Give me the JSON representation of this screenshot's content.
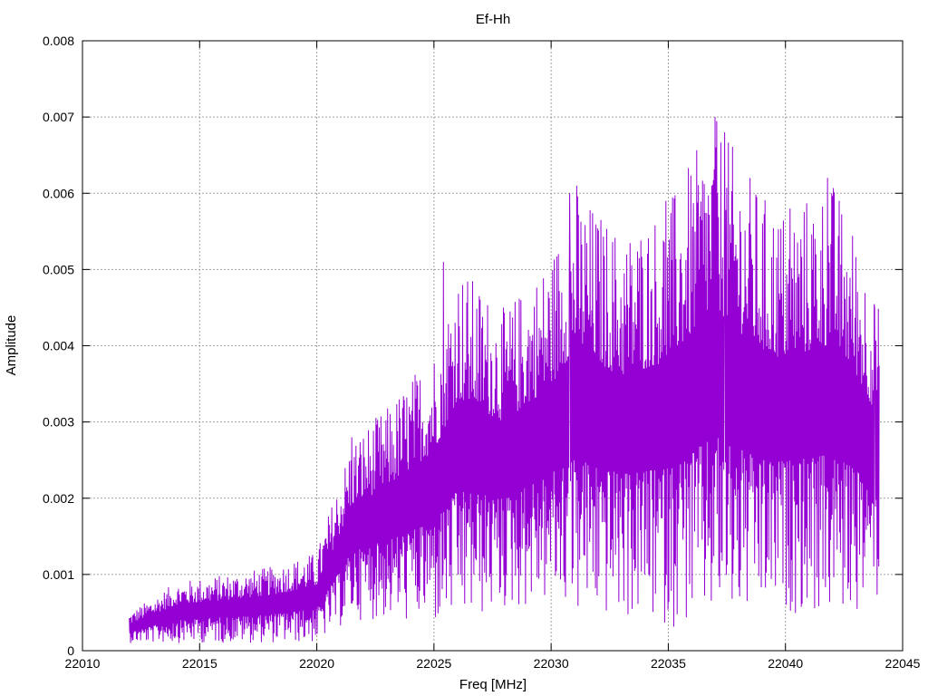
{
  "chart_data": {
    "type": "line",
    "title": "Ef-Hh",
    "xlabel": "Freq [MHz]",
    "ylabel": "Amplitude",
    "xlim": [
      22010,
      22045
    ],
    "ylim": [
      0,
      0.008
    ],
    "xticks": [
      "22010",
      "22015",
      "22020",
      "22025",
      "22030",
      "22035",
      "22040",
      "22045"
    ],
    "yticks": [
      "0",
      "0.001",
      "0.002",
      "0.003",
      "0.004",
      "0.005",
      "0.006",
      "0.007",
      "0.008"
    ],
    "grid": true,
    "series_color": "#9400d3",
    "series": [
      {
        "x_start": 22012.0,
        "x_end": 22044.0,
        "envelope": {
          "x": [
            22012,
            22014,
            22016,
            22018,
            22020,
            22021.5,
            22023,
            22025,
            22026,
            22028,
            22030,
            22031,
            22033,
            22035,
            22037,
            22039,
            22040,
            22042,
            22043,
            22044
          ],
          "low": [
            0.0001,
            0.0001,
            0.0001,
            0.0001,
            0.0001,
            0.0004,
            0.0004,
            0.0003,
            0.0003,
            0.0005,
            0.0006,
            0.0004,
            0.0004,
            0.0003,
            0.0003,
            0.0004,
            0.0005,
            0.0004,
            0.0005,
            0.0006
          ],
          "high": [
            0.0005,
            0.0009,
            0.001,
            0.0011,
            0.0013,
            0.0028,
            0.0032,
            0.004,
            0.0051,
            0.0045,
            0.0052,
            0.0061,
            0.0055,
            0.0059,
            0.007,
            0.006,
            0.0058,
            0.0062,
            0.0055,
            0.0045
          ]
        },
        "peaks": [
          {
            "x": 22037.0,
            "y": 0.007
          },
          {
            "x": 22037.4,
            "y": 0.0068
          },
          {
            "x": 22031.1,
            "y": 0.0061
          },
          {
            "x": 22030.8,
            "y": 0.006
          },
          {
            "x": 22041.8,
            "y": 0.0062
          },
          {
            "x": 22034.9,
            "y": 0.0059
          },
          {
            "x": 22040.2,
            "y": 0.0058
          },
          {
            "x": 22025.4,
            "y": 0.0051
          },
          {
            "x": 22021.5,
            "y": 0.0028
          },
          {
            "x": 22043.8,
            "y": 0.0045
          }
        ]
      }
    ]
  }
}
